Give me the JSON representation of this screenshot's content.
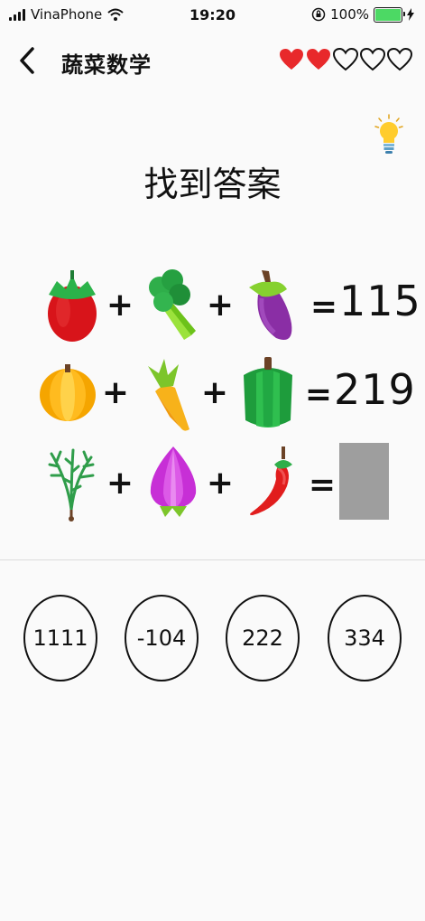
{
  "status_bar": {
    "carrier": "VinaPhone",
    "time": "19:20",
    "battery": "100%"
  },
  "header": {
    "title": "蔬菜数学",
    "lives": {
      "filled": 2,
      "total": 5
    }
  },
  "puzzle": {
    "prompt": "找到答案",
    "rows": [
      {
        "items": [
          "tomato",
          "broccoli",
          "eggplant"
        ],
        "operators": [
          "+",
          "+"
        ],
        "equals": "=",
        "result": "115"
      },
      {
        "items": [
          "pumpkin",
          "carrot",
          "green-pepper"
        ],
        "operators": [
          "+",
          "+"
        ],
        "equals": "=",
        "result": "219"
      },
      {
        "items": [
          "herb",
          "onion",
          "chili-pepper"
        ],
        "operators": [
          "+",
          "+"
        ],
        "equals": "=",
        "result": ""
      }
    ]
  },
  "answers": [
    "1111",
    "-104",
    "222",
    "334"
  ],
  "colors": {
    "heart": "#e8292b",
    "blank": "#9e9e9e",
    "battery": "#4cd964"
  }
}
